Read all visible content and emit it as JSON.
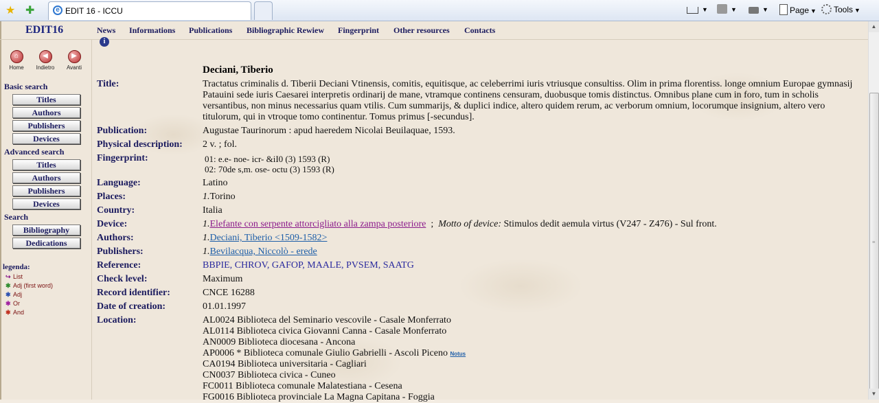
{
  "browser": {
    "tab_title": "EDIT 16 - ICCU",
    "page_menu": "Page",
    "tools_menu": "Tools"
  },
  "site": {
    "logo": "EDIT16",
    "nav": [
      "News",
      "Informations",
      "Publications",
      "Bibliographic Rewiew",
      "Fingerprint",
      "Other resources",
      "Contacts"
    ]
  },
  "sidebar": {
    "nav_buttons": [
      {
        "label": "Home",
        "icon": "home-icon"
      },
      {
        "label": "Indietro",
        "icon": "back-arrow-icon"
      },
      {
        "label": "Avanti",
        "icon": "forward-arrow-icon"
      }
    ],
    "basic_search": {
      "heading": "Basic search",
      "buttons": [
        "Titles",
        "Authors",
        "Publishers",
        "Devices"
      ]
    },
    "advanced_search": {
      "heading": "Advanced search",
      "buttons": [
        "Titles",
        "Authors",
        "Publishers",
        "Devices"
      ]
    },
    "search": {
      "heading": "Search",
      "buttons": [
        "Bibliography",
        "Dedications"
      ]
    },
    "legend": {
      "title": "legenda:",
      "items": [
        {
          "label": "List",
          "color": "#8b1a8b"
        },
        {
          "label": "Adj (first word)",
          "color": "#2e8b2e"
        },
        {
          "label": "Adj",
          "color": "#2a4fb0"
        },
        {
          "label": "Or",
          "color": "#a020a0"
        },
        {
          "label": "And",
          "color": "#c03020"
        }
      ]
    }
  },
  "record": {
    "heading": "Deciani, Tiberio",
    "labels": {
      "title": "Title:",
      "publication": "Publication:",
      "physical": "Physical description:",
      "fingerprint": "Fingerprint:",
      "language": "Language:",
      "places": "Places:",
      "country": "Country:",
      "device": "Device:",
      "authors": "Authors:",
      "publishers": "Publishers:",
      "reference": "Reference:",
      "check_level": "Check level:",
      "record_id": "Record identifier:",
      "date_creation": "Date of creation:",
      "location": "Location:"
    },
    "title": "Tractatus criminalis d. Tiberii Deciani Vtinensis, comitis, equitisque, ac celeberrimi iuris vtriusque consultiss. Olim in prima florentiss. longe omnium Europae gymnasij Patauini sede iuris Caesarei interpretis ordinarij de mane, vtramque continens censuram, duobusque tomis distinctus. Omnibus plane cum in foro, tum in scholis versantibus, non minus necessarius quam vtilis. Cum summarijs, & duplici indice, altero quidem rerum, ac verborum omnium, locorumque insignium, altero vero titulorum, qui in vtroque tomo continentur. Tomus primus [-secundus].",
    "publication": "Augustae Taurinorum : apud haeredem Nicolai Beuilaquae, 1593.",
    "physical": "2 v. ; fol.",
    "fingerprint": [
      "01: e.e- noe- icr- &iI0 (3) 1593 (R)",
      "02: 70de s,m. ose- octu (3) 1593 (R)"
    ],
    "language": "Latino",
    "places": {
      "num": "1.",
      "text": "Torino"
    },
    "country": "Italia",
    "device": {
      "num": "1.",
      "link": "Elefante con serpente attorcigliato alla zampa posteriore",
      "separator": ";",
      "motto_label": "Motto of device:",
      "motto": "Stimulos dedit aemula virtus (V247 - Z476) - Sul front."
    },
    "authors": {
      "num": "1.",
      "link": "Deciani, Tiberio <1509-1582>"
    },
    "publishers": {
      "num": "1.",
      "link": "Bevilacqua, Niccolò - erede"
    },
    "references": [
      "BBPIE,",
      "CHROV,",
      "GAFOP,",
      "MAALE,",
      "PVSEM,",
      "SAATG"
    ],
    "check_level": "Maximum",
    "record_id": "CNCE 16288",
    "date_creation": "01.01.1997",
    "locations": [
      "AL0024 Biblioteca del Seminario vescovile - Casale Monferrato",
      "AL0114 Biblioteca civica Giovanni Canna - Casale Monferrato",
      "AN0009 Biblioteca diocesana - Ancona",
      "AP0006 * Biblioteca comunale Giulio Gabrielli - Ascoli Piceno",
      "CA0194 Biblioteca universitaria - Cagliari",
      "CN0037 Biblioteca civica - Cuneo",
      "FC0011 Biblioteca comunale Malatestiana - Cesena",
      "FG0016 Biblioteca provinciale La Magna Capitana - Foggia"
    ],
    "notus": "Notus"
  }
}
